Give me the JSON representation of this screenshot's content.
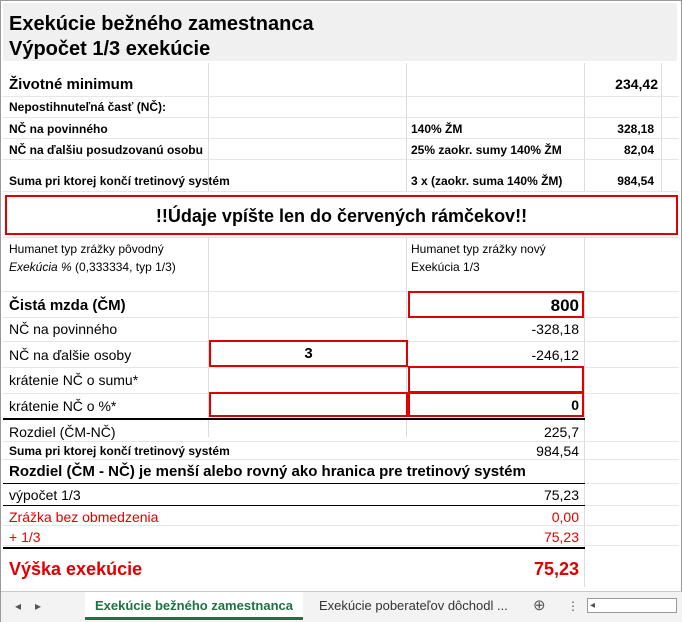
{
  "header": {
    "title": "Exekúcie bežného zamestnanca",
    "subtitle": "Výpočet   1/3 exekúcie"
  },
  "params": {
    "zivotne_minimum_label": "Životné minimum",
    "zivotne_minimum_value": "234,42",
    "nc_label": "Nepostihnuteľná časť (NČ):",
    "nc_povinny_label": "NČ na povinného",
    "nc_povinny_basis": "140% ŽM",
    "nc_povinny_value": "328,18",
    "nc_dalsia_label": "NČ na ďalšiu posudzovanú osobu",
    "nc_dalsia_basis": "25% zaokr. sumy 140% ŽM",
    "nc_dalsia_value": "82,04",
    "suma_label": "Suma pri ktorej končí tretinový systém",
    "suma_basis": "3 x (zaokr. suma 140% ŽM)",
    "suma_value": "984,54"
  },
  "notice": "!!Údaje vpíšte len do červených rámčekov!!",
  "humanet": {
    "old_label": "Humanet typ zrážky pôvodný",
    "old_value_italic": "Exekúcia %",
    "old_value_rest": " (0,333334, typ 1/3)",
    "new_label": "Humanet typ zrážky nový",
    "new_value": "Exekúcia 1/3"
  },
  "calc": {
    "cista_mzda_label": "Čistá mzda (ČM)",
    "cista_mzda_value": "800",
    "nc_povinny_label": "NČ na povinného",
    "nc_povinny_value": "-328,18",
    "nc_dalsie_label": "NČ na ďalšie osoby",
    "nc_dalsie_count": "3",
    "nc_dalsie_value": "-246,12",
    "kratenie_suma_label": "krátenie NČ o sumu*",
    "kratenie_pct_label": "krátenie NČ o %*",
    "kratenie_pct_value": "0",
    "rozdiel_label": "Rozdiel (ČM-NČ)",
    "rozdiel_value": "225,7",
    "suma_label": "Suma pri ktorej končí tretinový systém",
    "suma_value": "984,54",
    "statement": "Rozdiel (ČM - NČ) je menší alebo rovný ako hranica pre tretinový systém",
    "vypocet_label": "výpočet 1/3",
    "vypocet_value": "75,23",
    "zrazka_label": "Zrážka bez obmedzenia",
    "zrazka_value": "0,00",
    "plus_label": "+ 1/3",
    "plus_value": "75,23",
    "vyska_label": "Výška exekúcie",
    "vyska_value": "75,23"
  },
  "tabs": {
    "active": "Exekúcie bežného zamestnanca",
    "inactive": "Exekúcie poberateľov dôchodl ...",
    "add": "⊕",
    "more": "⋮",
    "prev": "◂",
    "next": "▸"
  },
  "colors": {
    "red": "#e00000",
    "tab_green": "#1e7145"
  }
}
